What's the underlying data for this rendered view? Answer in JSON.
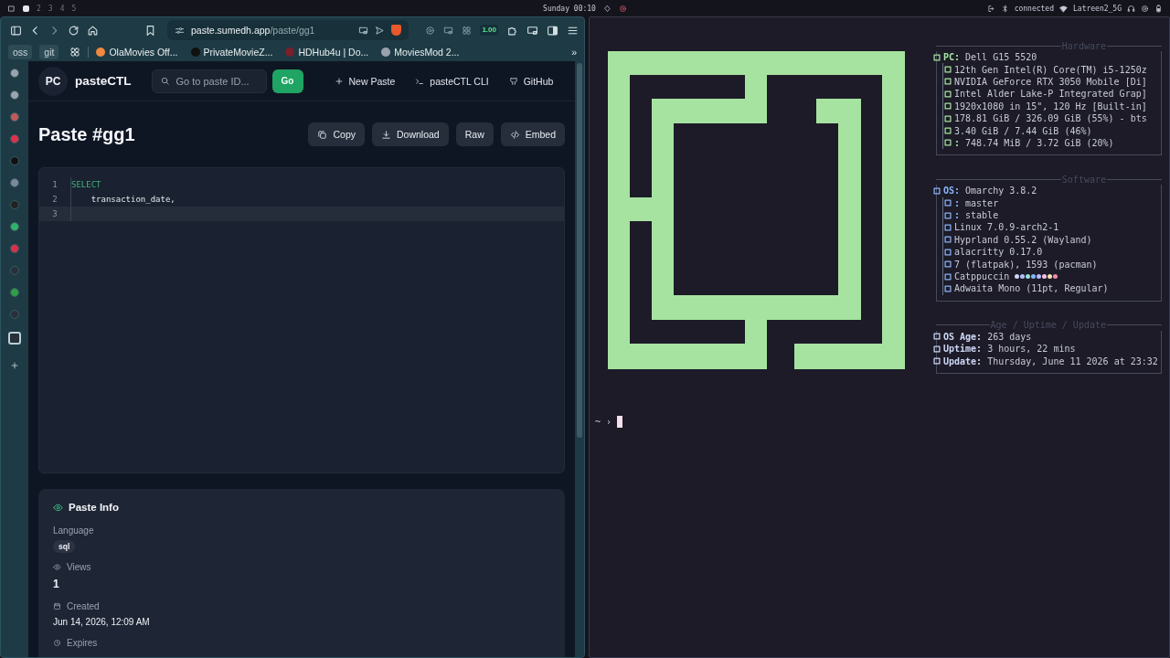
{
  "top_bar": {
    "workspaces": [
      {
        "selected": true
      },
      {
        "label": "2",
        "selected": false
      },
      {
        "label": "3",
        "selected": false
      },
      {
        "label": "4",
        "selected": false
      },
      {
        "label": "5",
        "selected": false
      }
    ],
    "clock": "Sunday 00:10",
    "bluetooth": "connected",
    "wifi": "Latreen2_5G"
  },
  "browser": {
    "url": {
      "host": "paste.sumedh.app",
      "path": "/paste/gg1"
    },
    "extension_badge": "1.00",
    "bookmark_folders": [
      "oss",
      "git"
    ],
    "bookmarks": [
      {
        "label": "OlaMovies Off...",
        "color": "#f0883e"
      },
      {
        "label": "PrivateMovieZ...",
        "color": "#111111"
      },
      {
        "label": "HDHub4u | Do...",
        "color": "#7a1f2b"
      },
      {
        "label": "MoviesMod 2...",
        "color": "#9aa3ad"
      }
    ],
    "overflow": "»",
    "side_panel": [
      {
        "color": "#9aa4ad",
        "selected": false
      },
      {
        "color": "#9aa4ad",
        "selected": false
      },
      {
        "color": "#c05a5a",
        "selected": false
      },
      {
        "color": "#e0304a",
        "selected": false
      },
      {
        "color": "#111111",
        "selected": false
      },
      {
        "color": "#7a8a9a",
        "selected": false
      },
      {
        "color": "#222222",
        "selected": false
      },
      {
        "color": "#2fb36a",
        "selected": false
      },
      {
        "color": "#d6304a",
        "selected": false
      },
      {
        "color": "#28303a",
        "selected": false
      },
      {
        "color": "#2f9e44",
        "selected": false
      },
      {
        "color": "#28303a",
        "selected": false
      },
      {
        "color": "#28303a",
        "selected": true
      }
    ]
  },
  "app": {
    "logo": "PC",
    "name": "pasteCTL",
    "search": {
      "placeholder": "Go to paste ID..."
    },
    "go_button": "Go",
    "nav": [
      {
        "kind": "plus",
        "label": "New Paste"
      },
      {
        "kind": "terminal",
        "label": "pasteCTL CLI"
      },
      {
        "kind": "github",
        "label": "GitHub"
      }
    ],
    "title": "Paste #gg1",
    "actions": [
      {
        "kind": "copy",
        "label": "Copy"
      },
      {
        "kind": "download",
        "label": "Download"
      },
      {
        "label": "Raw"
      },
      {
        "kind": "code",
        "label": "Embed"
      }
    ],
    "code": [
      {
        "number": "1",
        "tokens": [
          {
            "kind": "keyword",
            "text": "SELECT"
          }
        ],
        "active": false
      },
      {
        "number": "2",
        "tokens": [
          {
            "kind": "plain",
            "text": "    transaction_date,"
          }
        ],
        "active": false
      },
      {
        "number": "3",
        "active": true
      }
    ],
    "info": {
      "title": "Paste Info",
      "fields": [
        {
          "label": "Language",
          "tag": "sql"
        },
        {
          "kind": "eye",
          "label": "Views",
          "value": "1"
        },
        {
          "kind": "calendar",
          "label": "Created",
          "value": "Jun 14, 2026, 12:09 AM"
        },
        {
          "kind": "clock",
          "label": "Expires"
        }
      ]
    }
  },
  "terminal": {
    "sections": [
      {
        "title": "Hardware",
        "head": {
          "key": "PC:",
          "value": "Dell G15 5520"
        },
        "lines": [
          {
            "value": "12th Gen Intel(R) Core(TM) i5-1250z"
          },
          {
            "value": "NVIDIA GeForce RTX 3050 Mobile [Di]"
          },
          {
            "value": "Intel Alder Lake-P Integrated Grap]"
          },
          {
            "value": "1920x1080 in 15\", 120 Hz [Built-in]"
          },
          {
            "value": "178.81 GiB / 326.09 GiB (55%) - bts"
          },
          {
            "value": "3.40 GiB / 7.44 GiB (46%)"
          },
          {
            "key": ":",
            "value": "748.74 MiB / 3.72 GiB (20%)"
          }
        ]
      },
      {
        "title": "Software",
        "head": {
          "key": "OS:",
          "value": "Omarchy 3.8.2"
        },
        "lines": [
          {
            "key": ":",
            "value": "master"
          },
          {
            "key": ":",
            "value": "stable"
          },
          {
            "value": "Linux 7.0.9-arch2-1"
          },
          {
            "value": "Hyprland 0.55.2 (Wayland)"
          },
          {
            "value": "alacritty 0.17.0"
          },
          {
            "value": "7 (flatpak), 1593 (pacman)"
          },
          {
            "value": "Catppuccin",
            "palette": [
              {
                "color": "#cdd6f4"
              },
              {
                "color": "#b4befe"
              },
              {
                "color": "#94e2d5"
              },
              {
                "color": "#89b4fa"
              },
              {
                "color": "#b4befe"
              },
              {
                "color": "#f5c2e7"
              },
              {
                "color": "#f9e2af"
              },
              {
                "color": "#f38ba8"
              }
            ]
          },
          {
            "value": "Adwaita Mono (11pt, Regular)"
          }
        ]
      },
      {
        "title": "Age / Uptime / Update",
        "lines": [
          {
            "key": "OS Age:",
            "value": "263 days"
          },
          {
            "key": "Uptime:",
            "value": "3 hours, 22 mins"
          },
          {
            "key": "Update:",
            "value": "Thursday, June 11 2026 at 23:32"
          }
        ]
      }
    ],
    "prompt": "~ ›"
  }
}
